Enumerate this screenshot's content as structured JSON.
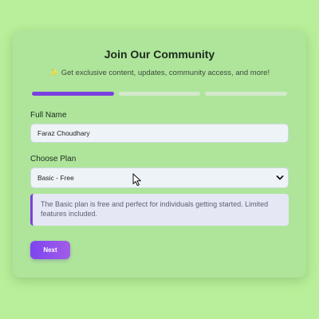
{
  "form": {
    "title": "Join Our Community",
    "subtitle": "Get exclusive content, updates, community access, and more!",
    "subtitle_icon": "party-popper-icon",
    "progress": {
      "current_step": 1,
      "total_steps": 3
    },
    "full_name": {
      "label": "Full Name",
      "value": "Faraz Choudhary"
    },
    "plan": {
      "label": "Choose Plan",
      "selected": "Basic - Free",
      "info": "The Basic plan is free and perfect for individuals getting started. Limited features included."
    },
    "next_label": "Next"
  },
  "colors": {
    "background": "#b9ef9a",
    "card": "#aee59b",
    "accent": "#7b3fe0",
    "progress_inactive": "#d3e9cc",
    "info_background": "#e5e7f5"
  }
}
